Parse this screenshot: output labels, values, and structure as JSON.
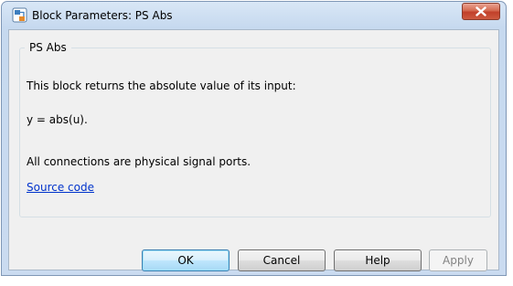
{
  "window": {
    "title": "Block Parameters: PS Abs"
  },
  "group": {
    "legend": "PS Abs",
    "description_lines": [
      "This block returns the absolute value of its input:",
      "y = abs(u).",
      "All connections are physical signal ports."
    ],
    "link_text": "Source code"
  },
  "buttons": {
    "ok": "OK",
    "cancel": "Cancel",
    "help": "Help",
    "apply": "Apply"
  },
  "colors": {
    "link": "#0033cc",
    "close_button": "#c9503a",
    "dialog_background": "#f0f0f0"
  },
  "icons": {
    "title": "simulink-block-icon",
    "close": "close-icon"
  }
}
